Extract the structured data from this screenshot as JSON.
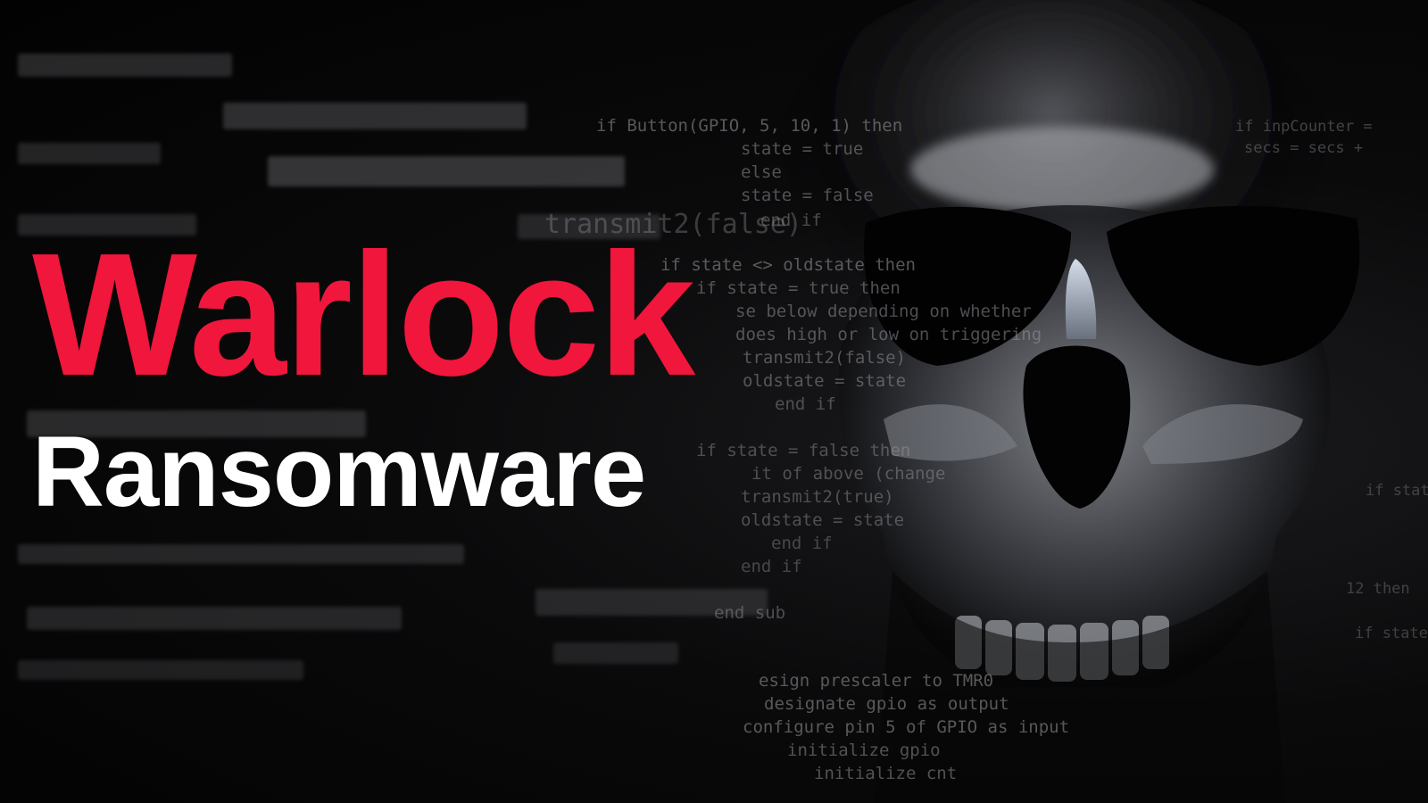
{
  "headline": {
    "line1": "Warlock",
    "line2": "Ransomware"
  },
  "background_code": [
    "if Button(GPIO, 5, 10, 1) then",
    "state = true",
    "else",
    "state = false",
    "transmit2(false)",
    "end if",
    "if state <> oldstate then",
    "if state = true then",
    "se below depending on whether",
    "does high or low on triggering",
    "transmit2(false)",
    "oldstate = state",
    "end if",
    "if state = false then",
    "it of above (change",
    "transmit2(true)",
    "oldstate = state",
    "end if",
    "end if",
    "end sub",
    "esign prescaler to TMR0",
    "designate gpio as output",
    "configure pin 5 of GPIO as input",
    "initialize gpio",
    "initialize cnt",
    "if inpCounter =",
    "secs = secs +",
    "if state",
    "12 then",
    "if state"
  ],
  "colors": {
    "accent": "#f0163c",
    "title_secondary": "#ffffff",
    "background": "#050505"
  },
  "icons": [
    "skull-icon"
  ]
}
